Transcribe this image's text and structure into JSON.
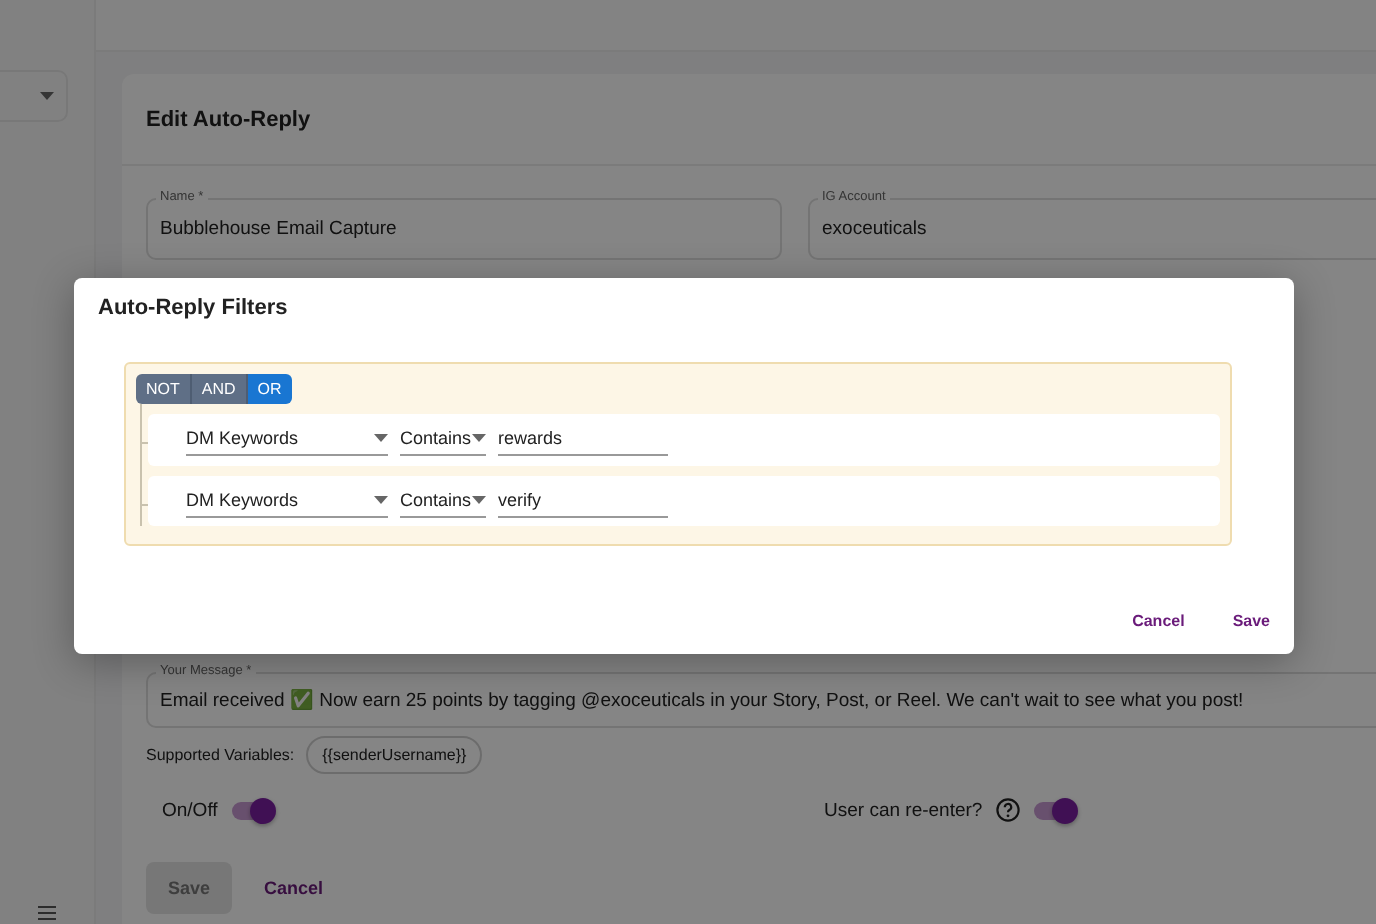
{
  "page": {
    "title": "Edit Auto-Reply",
    "fields": [
      {
        "label": "Name *",
        "value": "Bubblehouse Email Capture"
      },
      {
        "label": "IG Account",
        "value": "exoceuticals"
      }
    ],
    "message": {
      "label": "Your Message *",
      "value": "Email received ✅ Now earn 25 points by tagging @exoceuticals in your Story, Post, or Reel. We can't wait to see what you post!"
    },
    "variables": {
      "label": "Supported Variables:",
      "chips": [
        "{{senderUsername}}"
      ]
    },
    "toggles": [
      {
        "label": "On/Off",
        "on": true,
        "help": false
      },
      {
        "label": "User can re-enter?",
        "on": true,
        "help": true
      }
    ],
    "buttons": [
      {
        "label": "Save",
        "kind": "filled",
        "disabled": true
      },
      {
        "label": "Cancel",
        "kind": "text",
        "disabled": false
      }
    ]
  },
  "modal": {
    "title": "Auto-Reply Filters",
    "operators": [
      {
        "label": "NOT",
        "selected": false
      },
      {
        "label": "AND",
        "selected": false
      },
      {
        "label": "OR",
        "selected": true
      }
    ],
    "rules": [
      {
        "field": "DM Keywords",
        "operator": "Contains",
        "value": "rewards"
      },
      {
        "field": "DM Keywords",
        "operator": "Contains",
        "value": "verify"
      }
    ],
    "buttons": [
      "Cancel",
      "Save"
    ]
  }
}
